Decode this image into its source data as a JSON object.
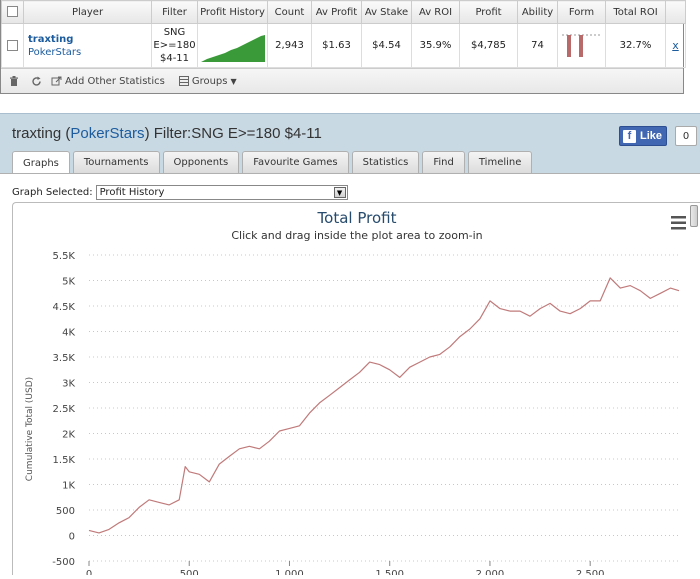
{
  "stats_table": {
    "columns": [
      "",
      "Player",
      "Filter",
      "Profit History",
      "Count",
      "Av Profit",
      "Av Stake",
      "Av ROI",
      "Profit",
      "Ability",
      "Form",
      "Total ROI"
    ],
    "row": {
      "player_name": "traxting",
      "player_site": "PokerStars",
      "filter_line1": "SNG",
      "filter_line2": "E>=180",
      "filter_line3": "$4-11",
      "count": "2,943",
      "av_profit": "$1.63",
      "av_stake": "$4.54",
      "av_roi": "35.9%",
      "profit": "$4,785",
      "ability": "74",
      "total_roi": "32.7%",
      "remove": "x"
    },
    "toolbar": {
      "add_stats": "Add Other Statistics",
      "groups": "Groups"
    },
    "colors": {
      "link": "#1c5c9e",
      "sparkline": "#3a9a3a",
      "form_bar": "#b86a6a"
    }
  },
  "panel": {
    "title_prefix": "traxting (",
    "title_site": "PokerStars",
    "title_suffix": ") Filter:SNG E>=180 $4-11",
    "fb_like": "Like",
    "fb_count": "0",
    "tabs": [
      "Graphs",
      "Tournaments",
      "Opponents",
      "Favourite Games",
      "Statistics",
      "Find",
      "Timeline"
    ],
    "active_tab": "Graphs",
    "graph_selected_label": "Graph Selected:",
    "graph_selected_value": "Profit History"
  },
  "chart_data": {
    "type": "line",
    "title": "Total Profit",
    "subtitle": "Click and drag inside the plot area to zoom-in",
    "ylabel": "Cumulative Total (USD)",
    "xlabel": "",
    "xlim": [
      0,
      2943
    ],
    "ylim": [
      -500,
      5500
    ],
    "yticks": [
      -500,
      0,
      500,
      1000,
      1500,
      2000,
      2500,
      3000,
      3500,
      4000,
      4500,
      5000,
      5500
    ],
    "ytick_labels": [
      "-500",
      "0",
      "500",
      "1K",
      "1.5K",
      "2K",
      "2.5K",
      "3K",
      "3.5K",
      "4K",
      "4.5K",
      "5K",
      "5.5K"
    ],
    "xticks": [
      0,
      500,
      1000,
      1500,
      2000,
      2500
    ],
    "xtick_labels": [
      "0",
      "500",
      "1,000",
      "1,500",
      "2,000",
      "2,500"
    ],
    "grid": true,
    "series_color": "#c07a7a",
    "series": [
      {
        "x": [
          0,
          50,
          100,
          150,
          200,
          250,
          300,
          350,
          400,
          450,
          480,
          500,
          550,
          600,
          650,
          700,
          750,
          800,
          850,
          900,
          950,
          1000,
          1050,
          1100,
          1150,
          1200,
          1250,
          1300,
          1350,
          1400,
          1450,
          1500,
          1550,
          1600,
          1650,
          1700,
          1750,
          1800,
          1850,
          1900,
          1950,
          2000,
          2050,
          2100,
          2150,
          2200,
          2250,
          2300,
          2350,
          2400,
          2450,
          2500,
          2550,
          2600,
          2650,
          2700,
          2750,
          2800,
          2850,
          2900,
          2943
        ],
        "values": [
          100,
          50,
          120,
          250,
          350,
          550,
          700,
          650,
          600,
          700,
          1350,
          1250,
          1200,
          1050,
          1400,
          1550,
          1700,
          1750,
          1700,
          1850,
          2050,
          2100,
          2150,
          2400,
          2600,
          2750,
          2900,
          3050,
          3200,
          3400,
          3350,
          3250,
          3100,
          3300,
          3400,
          3500,
          3550,
          3700,
          3900,
          4050,
          4250,
          4600,
          4450,
          4400,
          4400,
          4300,
          4450,
          4550,
          4400,
          4350,
          4450,
          4600,
          4600,
          5050,
          4850,
          4900,
          4800,
          4650,
          4750,
          4850,
          4800
        ]
      }
    ]
  }
}
